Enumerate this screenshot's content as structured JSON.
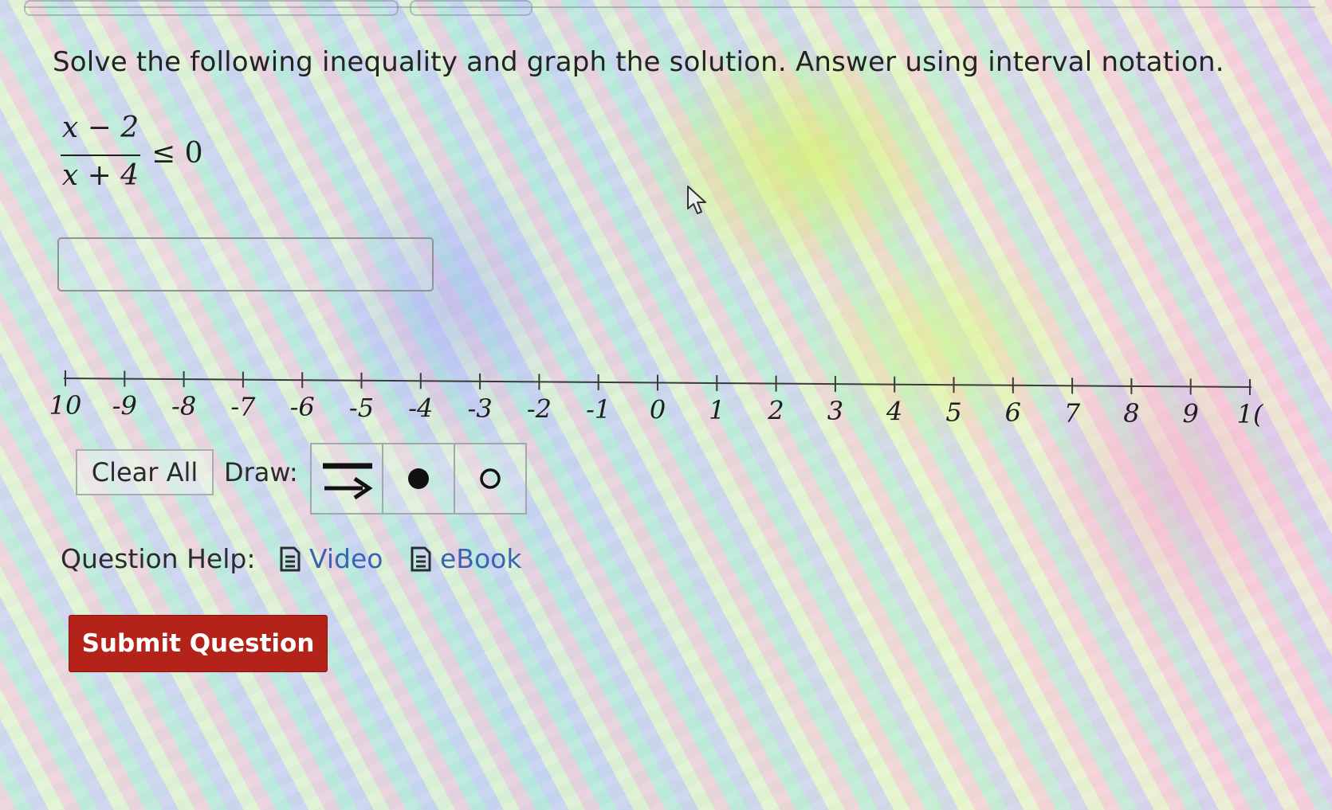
{
  "question": {
    "prompt": "Solve the following inequality and graph the solution. Answer using interval notation.",
    "inequality": {
      "numerator": "x − 2",
      "denominator": "x + 4",
      "relation": "≤ 0"
    }
  },
  "answer_input": {
    "value": "",
    "placeholder": ""
  },
  "number_line": {
    "min": -10,
    "max": 10,
    "step": 1,
    "tick_labels": [
      "10",
      "-9",
      "-8",
      "-7",
      "-6",
      "-5",
      "-4",
      "-3",
      "-2",
      "-1",
      "0",
      "1",
      "2",
      "3",
      "4",
      "5",
      "6",
      "7",
      "8",
      "9",
      "1("
    ]
  },
  "toolbar": {
    "clear_label": "Clear All",
    "draw_label": "Draw:",
    "tools": [
      {
        "icon": "ray-arrow-icon"
      },
      {
        "icon": "closed-dot-icon"
      },
      {
        "icon": "open-dot-icon"
      }
    ]
  },
  "help": {
    "label": "Question Help:",
    "links": [
      {
        "label": "Video",
        "icon": "document-icon"
      },
      {
        "label": "eBook",
        "icon": "document-icon"
      }
    ]
  },
  "submit_label": "Submit Question",
  "colors": {
    "submit_bg": "#b3231a",
    "link": "#3b63b3"
  }
}
